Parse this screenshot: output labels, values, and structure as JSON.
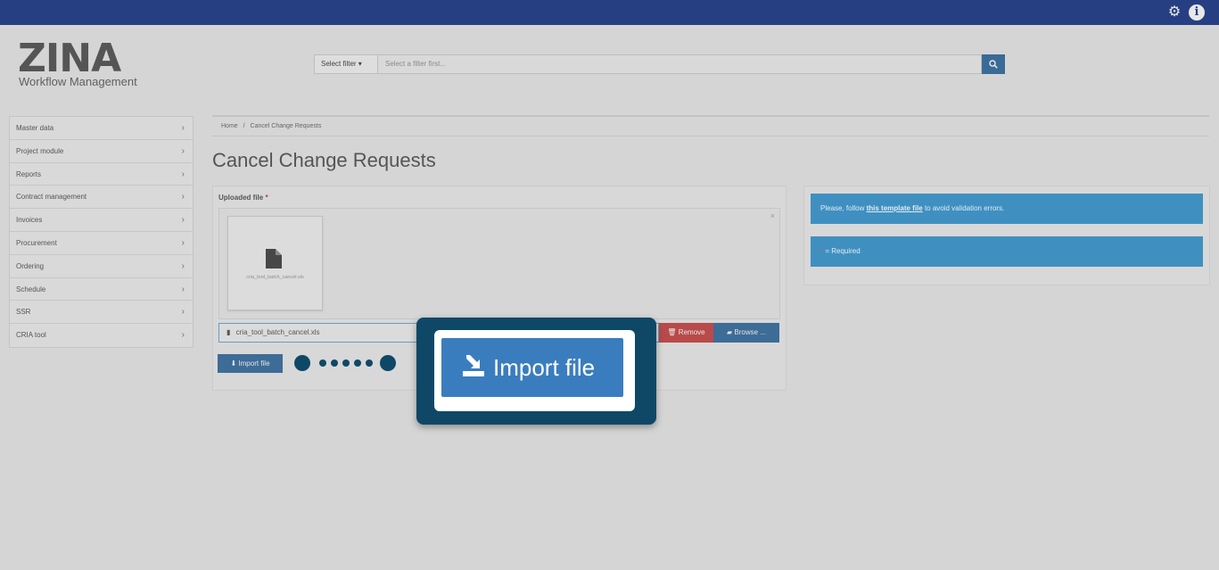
{
  "header": {
    "settings_icon": "gear-icon",
    "info_icon": "info-icon",
    "info_glyph": "i"
  },
  "logo": {
    "brand": "ZINA",
    "subtitle": "Workflow Management"
  },
  "search": {
    "filter_label": "Select filter ▾",
    "placeholder": "Select a filter first..."
  },
  "sidebar": {
    "items": [
      {
        "label": "Master data"
      },
      {
        "label": "Project module"
      },
      {
        "label": "Reports"
      },
      {
        "label": "Contract management"
      },
      {
        "label": "Invoices"
      },
      {
        "label": "Procurement"
      },
      {
        "label": "Ordering"
      },
      {
        "label": "Schedule"
      },
      {
        "label": "SSR"
      },
      {
        "label": "CRIA tool"
      }
    ]
  },
  "breadcrumb": {
    "home": "Home",
    "separator": "/",
    "current": "Cancel Change Requests"
  },
  "page": {
    "title": "Cancel Change Requests"
  },
  "upload": {
    "label": "Uploaded file",
    "required_mark": "*",
    "close": "×",
    "thumbnail_name": "cria_tool_batch_cancel.xls",
    "file_name": "cria_tool_batch_cancel.xls",
    "remove_label": "Remove",
    "browse_label": "Browse ...",
    "import_label": "Import file"
  },
  "info": {
    "note_prefix": "Please, follow ",
    "note_link": "this template file",
    "note_suffix": " to avoid validation errors.",
    "required_star": "*",
    "required_label": " = Required"
  },
  "callout": {
    "label": "Import file",
    "icon": "import-icon"
  },
  "colors": {
    "topbar": "#263f83",
    "primary": "#3a7dbf",
    "danger": "#b94a4a",
    "callout_border": "#0f4867",
    "info_box": "#3f90c1"
  }
}
